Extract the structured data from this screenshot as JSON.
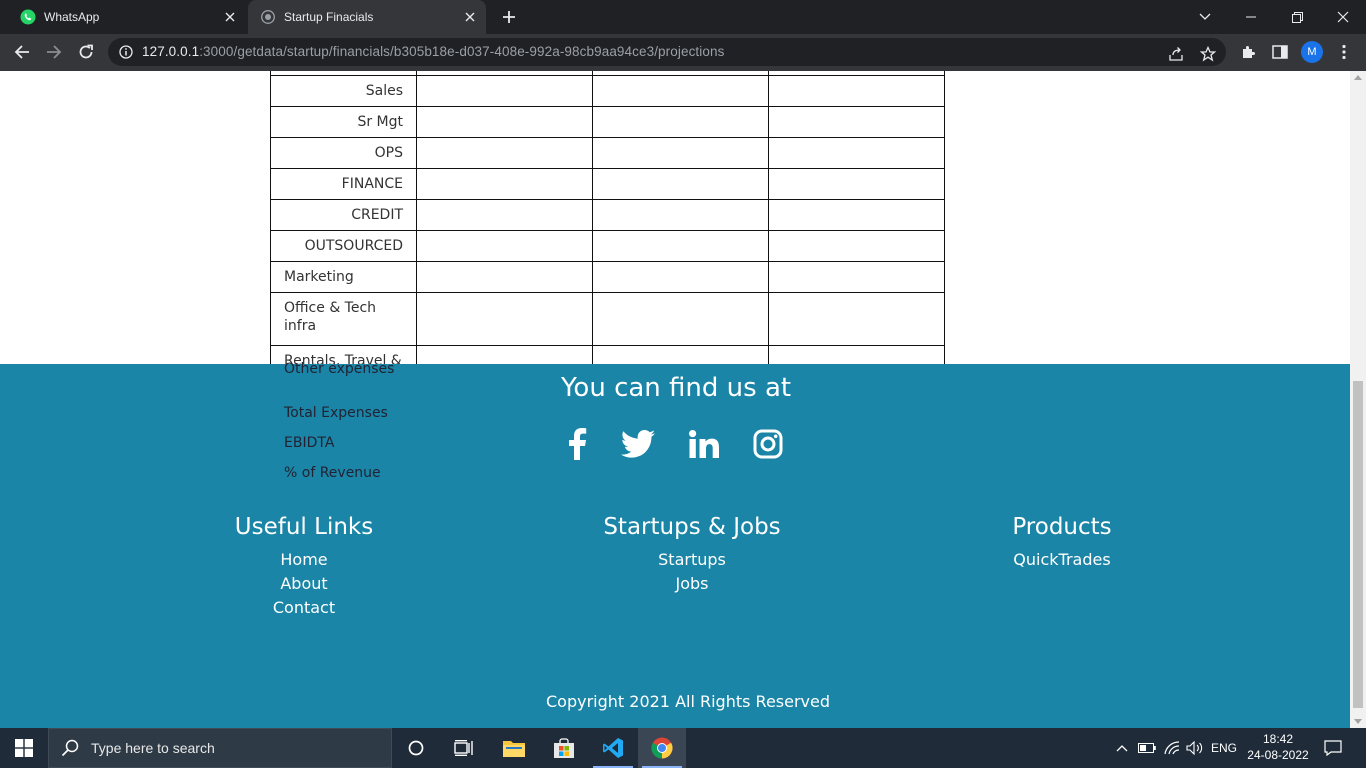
{
  "browser": {
    "tabs": [
      {
        "title": "WhatsApp",
        "icon": "whatsapp-icon",
        "active": false
      },
      {
        "title": "Startup Finacials",
        "icon": "globe-icon",
        "active": true
      }
    ],
    "url_host": "127.0.0.1",
    "url_rest": ":3000/getdata/startup/financials/b305b18e-d037-408e-992a-98cb9aa94ce3/projections",
    "profile_initial": "M"
  },
  "table": {
    "rows": [
      {
        "label": "",
        "align": "right"
      },
      {
        "label": "Sales",
        "align": "right"
      },
      {
        "label": "Sr Mgt",
        "align": "right"
      },
      {
        "label": "OPS",
        "align": "right"
      },
      {
        "label": "FINANCE",
        "align": "right"
      },
      {
        "label": "CREDIT",
        "align": "right"
      },
      {
        "label": "OUTSOURCED",
        "align": "right"
      },
      {
        "label": "Marketing",
        "align": "left"
      },
      {
        "label": "Office & Tech infra",
        "align": "left"
      },
      {
        "label": "Rentals, Travel & Other expenses",
        "align": "left"
      }
    ],
    "overflow_rows": [
      "Total Expenses",
      "EBIDTA",
      "% of Revenue"
    ]
  },
  "footer": {
    "find_us": "You can find us at",
    "social": [
      "facebook-icon",
      "twitter-icon",
      "linkedin-icon",
      "instagram-icon"
    ],
    "columns": [
      {
        "heading": "Useful Links",
        "links": [
          "Home",
          "About",
          "Contact"
        ]
      },
      {
        "heading": "Startups & Jobs",
        "links": [
          "Startups",
          "Jobs"
        ]
      },
      {
        "heading": "Products",
        "links": [
          "QuickTrades"
        ]
      }
    ],
    "copyright": "Copyright 2021 All Rights Reserved"
  },
  "taskbar": {
    "search_placeholder": "Type here to search",
    "language": "ENG",
    "time": "18:42",
    "date": "24-08-2022"
  },
  "colors": {
    "footer_bg": "#1a85a6",
    "chrome_dark": "#202124",
    "chrome_toolbar": "#35363a",
    "taskbar_bg": "#1f2b38"
  }
}
